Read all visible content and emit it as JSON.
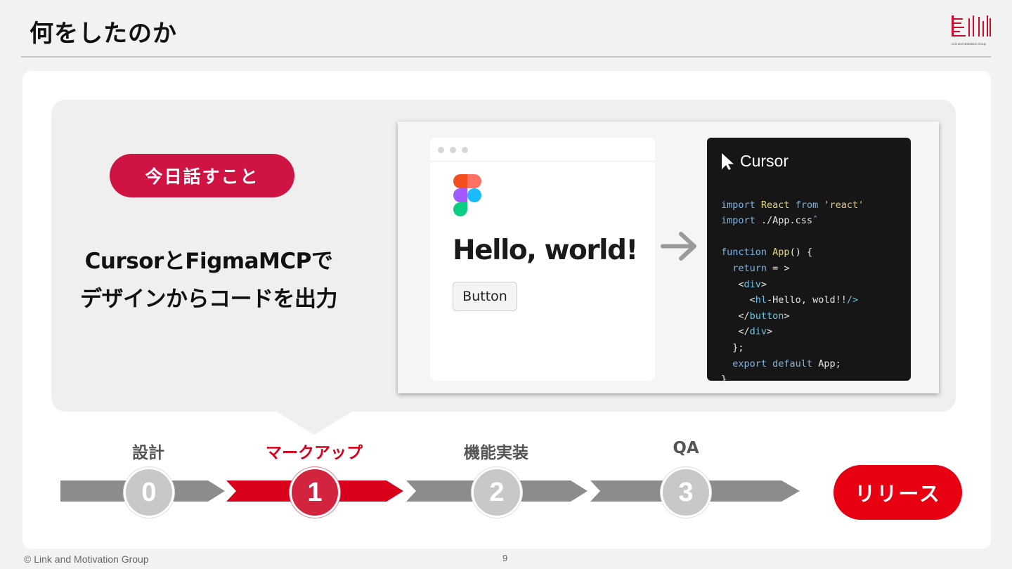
{
  "header": {
    "title": "何をしたのか",
    "logo_text": "Link and Motivation Group"
  },
  "callout": {
    "pill_label": "今日話すこと",
    "headline_lines": [
      "CursorとFigmaMCPで",
      "デザインからコードを出力"
    ]
  },
  "illustration": {
    "hello_text": "Hello, world!",
    "button_label": "Button",
    "editor_brand": "Cursor",
    "code_lines": [
      "import React from 'react'",
      "import ./App.cssˆ",
      "",
      "function App() {",
      "  return = >",
      "   <div>",
      "     <hl-Hello, wold!!/>",
      "   </button>",
      "   </div>",
      "  };",
      "  export default App;",
      "}"
    ]
  },
  "timeline": {
    "stages": [
      {
        "label": "設計",
        "number": "0",
        "active": false
      },
      {
        "label": "マークアップ",
        "number": "1",
        "active": true
      },
      {
        "label": "機能実装",
        "number": "2",
        "active": false
      },
      {
        "label": "QA",
        "number": "3",
        "active": false
      }
    ],
    "final_label": "リリース"
  },
  "colors": {
    "accent_red": "#d9001b",
    "pill_red": "#cf1444",
    "release_red": "#e60012",
    "inactive_gray": "#8c8c8c"
  },
  "footer": {
    "copyright": "© Link and Motivation Group",
    "page_number": "9"
  }
}
